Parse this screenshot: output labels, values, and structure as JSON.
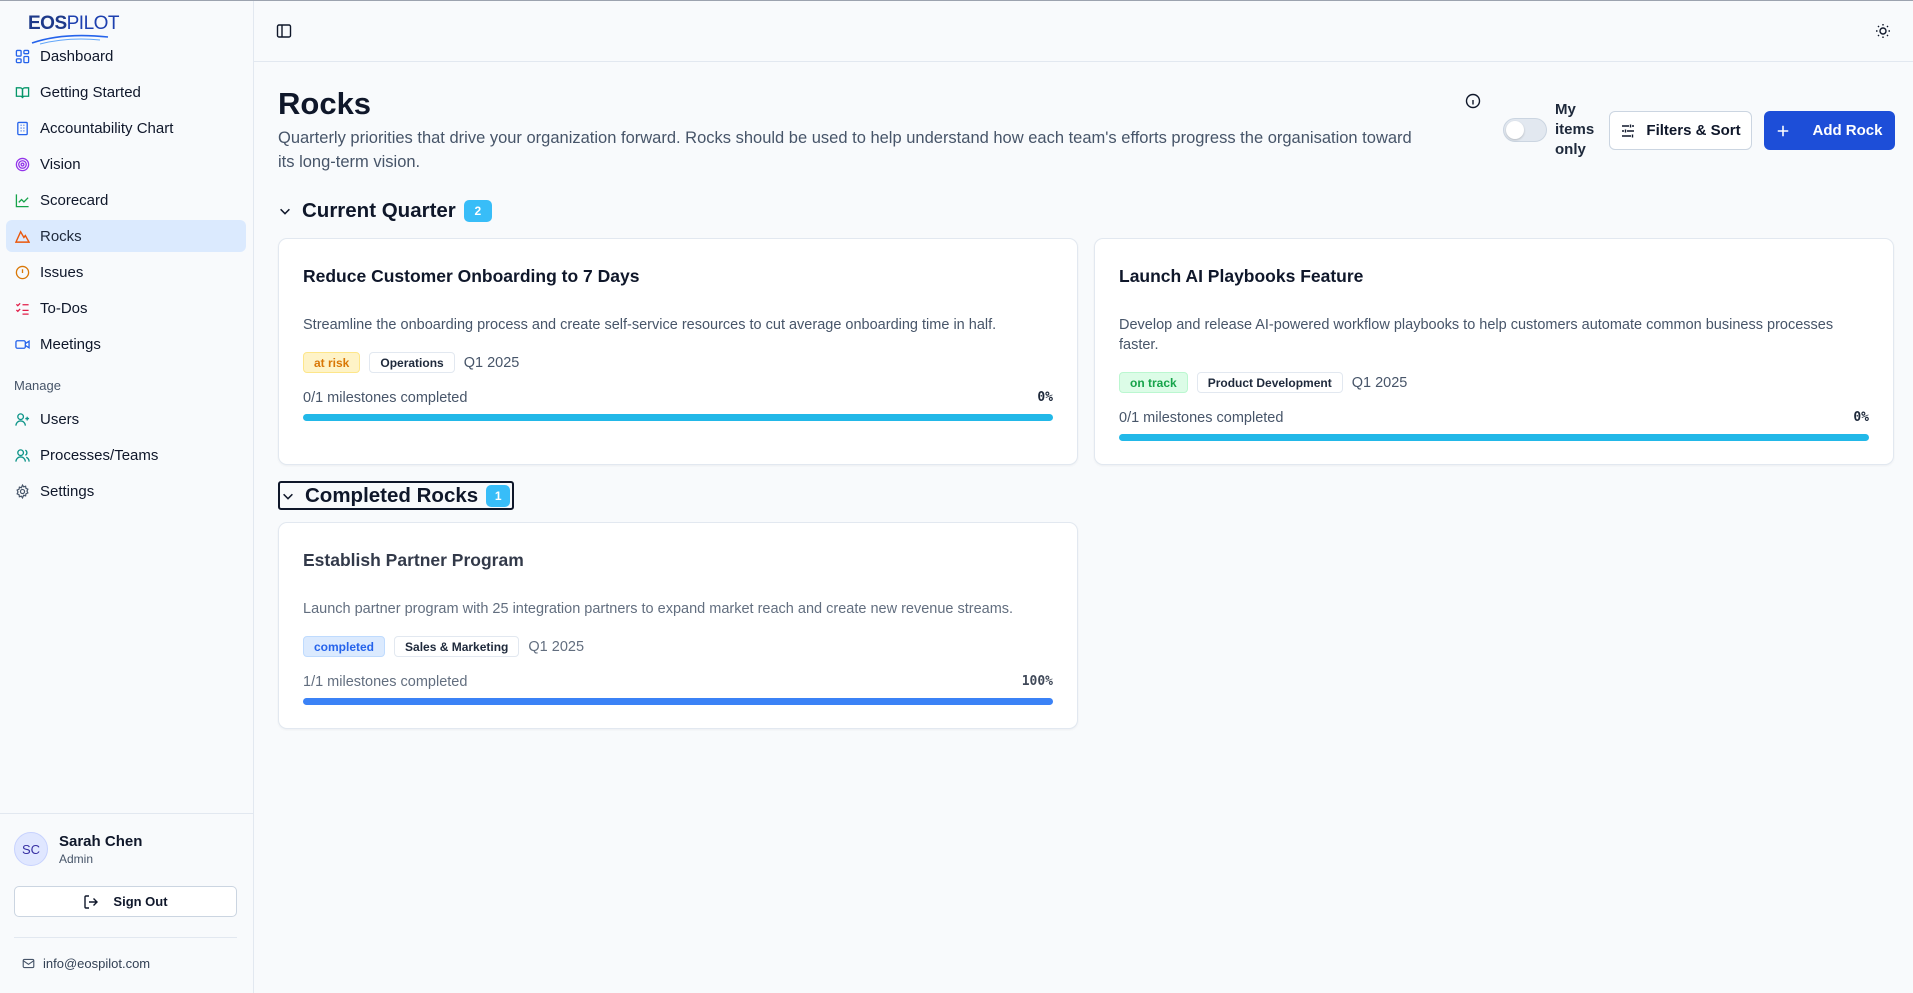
{
  "app": {
    "logo_primary": "EOS",
    "logo_secondary": "PILOT"
  },
  "sidebar": {
    "items": [
      {
        "label": "Dashboard",
        "icon": "dashboard-icon"
      },
      {
        "label": "Getting Started",
        "icon": "book-open-icon"
      },
      {
        "label": "Accountability Chart",
        "icon": "building-icon"
      },
      {
        "label": "Vision",
        "icon": "target-icon"
      },
      {
        "label": "Scorecard",
        "icon": "line-chart-icon"
      },
      {
        "label": "Rocks",
        "icon": "mountain-icon",
        "active": true
      },
      {
        "label": "Issues",
        "icon": "alert-circle-icon"
      },
      {
        "label": "To-Dos",
        "icon": "list-todo-icon"
      },
      {
        "label": "Meetings",
        "icon": "video-icon"
      }
    ],
    "manage_label": "Manage",
    "manage_items": [
      {
        "label": "Users",
        "icon": "user-plus-icon"
      },
      {
        "label": "Processes/Teams",
        "icon": "users-icon"
      },
      {
        "label": "Settings",
        "icon": "gear-icon"
      }
    ],
    "user": {
      "initials": "SC",
      "name": "Sarah Chen",
      "role": "Admin"
    },
    "sign_out_label": "Sign Out",
    "email": "info@eospilot.com"
  },
  "page": {
    "title": "Rocks",
    "description": "Quarterly priorities that drive your organization forward. Rocks should be used to help understand how each team's efforts progress the organisation toward its long-term vision.",
    "my_items_label": "My items only",
    "my_items_on": false,
    "filters_label": "Filters & Sort",
    "add_label": "Add Rock"
  },
  "sections": {
    "current": {
      "title": "Current Quarter",
      "count": "2",
      "rocks": [
        {
          "title": "Reduce Customer Onboarding to 7 Days",
          "description": "Streamline the onboarding process and create self-service resources to cut average onboarding time in half.",
          "status": "at risk",
          "team": "Operations",
          "quarter": "Q1 2025",
          "milestones": "0/1 milestones completed",
          "percent": "0%",
          "progress": 0
        },
        {
          "title": "Launch AI Playbooks Feature",
          "description": "Develop and release AI-powered workflow playbooks to help customers automate common business processes faster.",
          "status": "on track",
          "team": "Product Development",
          "quarter": "Q1 2025",
          "milestones": "0/1 milestones completed",
          "percent": "0%",
          "progress": 0
        }
      ]
    },
    "completed": {
      "title": "Completed Rocks",
      "count": "1",
      "rocks": [
        {
          "title": "Establish Partner Program",
          "description": "Launch partner program with 25 integration partners to expand market reach and create new revenue streams.",
          "status": "completed",
          "team": "Sales & Marketing",
          "quarter": "Q1 2025",
          "milestones": "1/1 milestones completed",
          "percent": "100%",
          "progress": 1
        }
      ]
    }
  },
  "colors": {
    "accent": "#1d4ed8",
    "progress_current": "#22b8e8",
    "progress_completed": "#3b82f6",
    "badge": "#38bdf8"
  }
}
